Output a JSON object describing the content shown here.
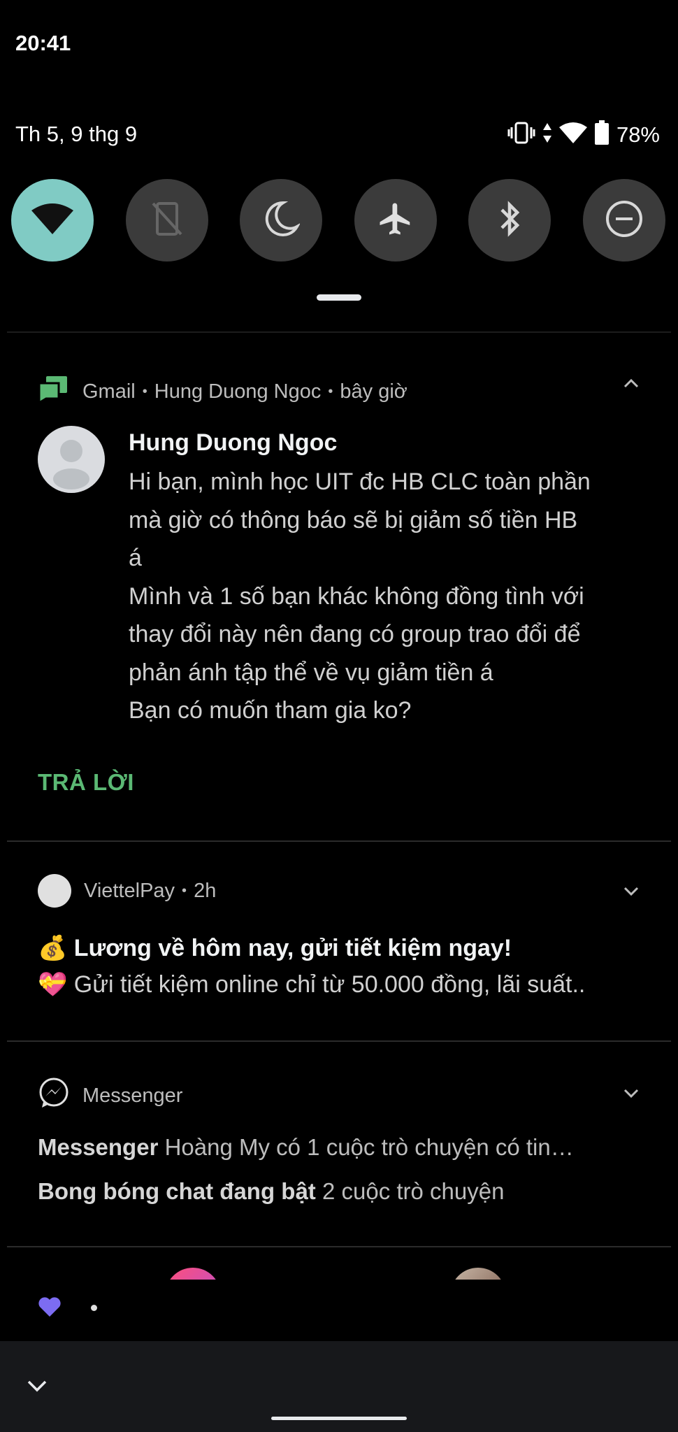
{
  "status": {
    "time": "20:41",
    "date": "Th 5, 9 thg 9",
    "battery": "78%"
  },
  "quick_settings": [
    {
      "name": "wifi",
      "icon": "wifi-icon",
      "active": true
    },
    {
      "name": "auto-rotate",
      "icon": "rotate-off-icon",
      "active": false
    },
    {
      "name": "night-light",
      "icon": "moon-icon",
      "active": false
    },
    {
      "name": "airplane-mode",
      "icon": "airplane-icon",
      "active": false
    },
    {
      "name": "bluetooth",
      "icon": "bluetooth-icon",
      "active": false
    },
    {
      "name": "do-not-disturb",
      "icon": "dnd-icon",
      "active": false
    }
  ],
  "gmail": {
    "app": "Gmail",
    "account": "Hung Duong Ngoc",
    "time": "bây giờ",
    "sender": "Hung Duong Ngoc",
    "message": "Hi bạn, mình học UIT đc HB CLC toàn phần\nmà giờ có thông báo sẽ bị giảm số tiền HB\ná\nMình và 1 số bạn khác không đồng tình với\nthay đổi này nên đang có group trao đổi để\nphản ánh tập thể về vụ giảm tiền á\nBạn có muốn tham gia ko?",
    "reply_label": "TRẢ LỜI"
  },
  "viettelpay": {
    "app": "ViettelPay",
    "time": "2h",
    "title_emoji": "💰",
    "title": "Lương về hôm nay, gửi tiết kiệm ngay!",
    "body_emoji": "💝",
    "body": "Gửi tiết kiệm online chỉ từ 50.000 đồng, lãi suất.."
  },
  "messenger": {
    "app": "Messenger",
    "line1_bold": "Messenger",
    "line1_text": "Hoàng My có 1 cuộc trò chuyện có tin…",
    "line2_bold": "Bong bóng chat đang bật",
    "line2_text": "2 cuộc trò chuyện"
  },
  "colors": {
    "accent_teal": "#80cbc4",
    "gmail_green": "#5bb974",
    "heart_purple": "#7c6cf2"
  }
}
